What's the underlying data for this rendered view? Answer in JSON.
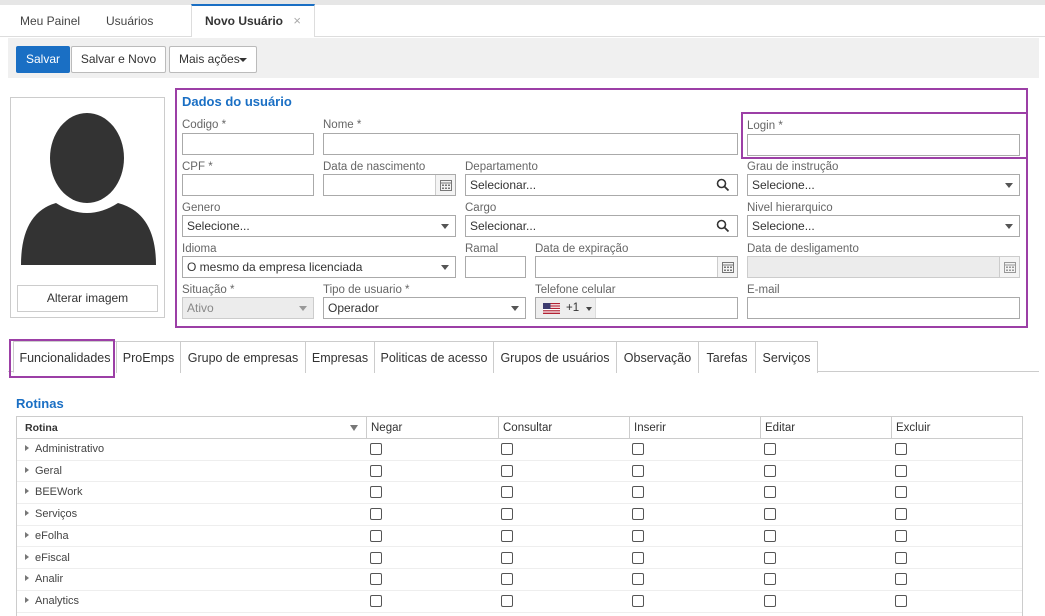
{
  "tabs_top": [
    {
      "label": "Meu Painel"
    },
    {
      "label": "Usuários"
    },
    {
      "label": "Novo Usuário",
      "close": "×"
    }
  ],
  "toolbar": {
    "save": "Salvar",
    "save_new": "Salvar e Novo",
    "more": "Mais ações"
  },
  "photo": {
    "change_label": "Alterar imagem"
  },
  "user_section": {
    "title": "Dados do usuário",
    "fields": {
      "codigo": {
        "label": "Codigo *",
        "value": ""
      },
      "nome": {
        "label": "Nome *",
        "value": ""
      },
      "login": {
        "label": "Login *",
        "value": ""
      },
      "cpf": {
        "label": "CPF *",
        "value": ""
      },
      "nascimento": {
        "label": "Data de nascimento",
        "value": ""
      },
      "departamento": {
        "label": "Departamento",
        "value": "Selecionar..."
      },
      "grau": {
        "label": "Grau de instrução",
        "value": "Selecione..."
      },
      "genero": {
        "label": "Genero",
        "value": "Selecione..."
      },
      "cargo": {
        "label": "Cargo",
        "value": "Selecionar..."
      },
      "nivel": {
        "label": "Nivel hierarquico",
        "value": "Selecione..."
      },
      "idioma": {
        "label": "Idioma",
        "value": "O mesmo da empresa licenciada"
      },
      "ramal": {
        "label": "Ramal",
        "value": ""
      },
      "expiracao": {
        "label": "Data de expiração",
        "value": ""
      },
      "desligamento": {
        "label": "Data de desligamento",
        "value": ""
      },
      "situacao": {
        "label": "Situação *",
        "value": "Ativo"
      },
      "tipo": {
        "label": "Tipo de usuario *",
        "value": "Operador"
      },
      "telefone": {
        "label": "Telefone celular",
        "code": "+1"
      },
      "email": {
        "label": "E-mail",
        "value": ""
      }
    }
  },
  "tabs2": [
    {
      "label": "Funcionalidades"
    },
    {
      "label": "ProEmps"
    },
    {
      "label": "Grupo de empresas"
    },
    {
      "label": "Empresas"
    },
    {
      "label": "Politicas de acesso"
    },
    {
      "label": "Grupos de usuários"
    },
    {
      "label": "Observação"
    },
    {
      "label": "Tarefas"
    },
    {
      "label": "Serviços"
    }
  ],
  "routines": {
    "title": "Rotinas",
    "columns": [
      "Rotina",
      "Negar",
      "Consultar",
      "Inserir",
      "Editar",
      "Excluir"
    ],
    "rows": [
      {
        "name": "Administrativo"
      },
      {
        "name": "Geral"
      },
      {
        "name": "BEEWork"
      },
      {
        "name": "Serviços"
      },
      {
        "name": "eFolha"
      },
      {
        "name": "eFiscal"
      },
      {
        "name": "Analir"
      },
      {
        "name": "Analytics"
      }
    ]
  },
  "colors": {
    "accent": "#1a6fc4",
    "highlight": "#9c3fa6"
  }
}
